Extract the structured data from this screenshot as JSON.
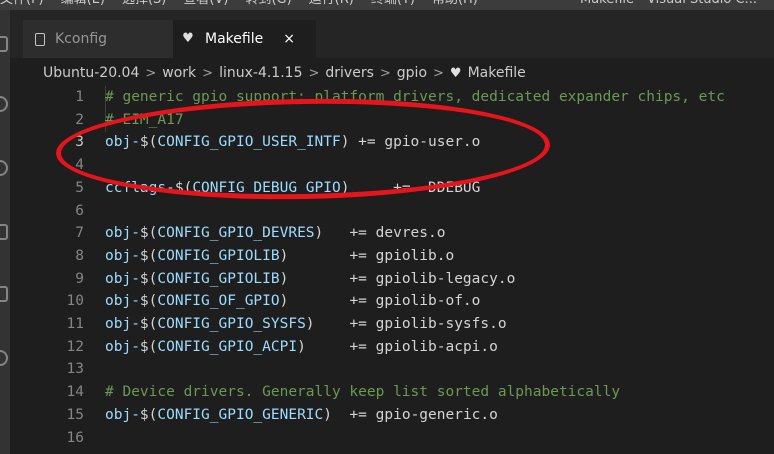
{
  "menu": {
    "items": [
      "文件(F)",
      "编辑(E)",
      "选择(S)",
      "查看(V)",
      "转到(G)",
      "运行(R)",
      "终端(T)",
      "帮助(H)"
    ],
    "window_title": "Makefile - Visual Studio C..."
  },
  "activity_icons": [
    "explorer-icon",
    "search-icon",
    "source-control-icon",
    "run-debug-icon",
    "extensions-icon",
    "remote-icon"
  ],
  "tabs": [
    {
      "label": "Kconfig",
      "icon": "file-icon",
      "active": false
    },
    {
      "label": "Makefile",
      "icon": "makefile-icon",
      "active": true,
      "close_glyph": "×"
    }
  ],
  "breadcrumb": [
    "Ubuntu-20.04",
    "work",
    "linux-4.1.15",
    "drivers",
    "gpio",
    "Makefile"
  ],
  "breadcrumb_sep": ">",
  "code_lines": [
    {
      "n": "1",
      "parts": [
        [
          "# generic gpio support: platform drivers, dedicated expander chips, etc",
          "c-comment"
        ]
      ]
    },
    {
      "n": "2",
      "parts": [
        [
          "# EIM_A17",
          "c-comment"
        ]
      ]
    },
    {
      "n": "3",
      "parts": [
        [
          "obj-",
          "c-var"
        ],
        [
          "$(",
          "c-op"
        ],
        [
          "CONFIG_GPIO_USER_INTF",
          "c-var"
        ],
        [
          ") += gpio-user.o",
          "c-text"
        ]
      ]
    },
    {
      "n": "4",
      "parts": []
    },
    {
      "n": "5",
      "parts": [
        [
          "ccflags-",
          "c-var"
        ],
        [
          "$(",
          "c-op"
        ],
        [
          "CONFIG_DEBUG_GPIO",
          "c-var"
        ],
        [
          ")     += -DDEBUG",
          "c-text"
        ]
      ]
    },
    {
      "n": "6",
      "parts": []
    },
    {
      "n": "7",
      "parts": [
        [
          "obj-",
          "c-var"
        ],
        [
          "$(",
          "c-op"
        ],
        [
          "CONFIG_GPIO_DEVRES",
          "c-var"
        ],
        [
          ")   += devres.o",
          "c-text"
        ]
      ]
    },
    {
      "n": "8",
      "parts": [
        [
          "obj-",
          "c-var"
        ],
        [
          "$(",
          "c-op"
        ],
        [
          "CONFIG_GPIOLIB",
          "c-var"
        ],
        [
          ")       += gpiolib.o",
          "c-text"
        ]
      ]
    },
    {
      "n": "9",
      "parts": [
        [
          "obj-",
          "c-var"
        ],
        [
          "$(",
          "c-op"
        ],
        [
          "CONFIG_GPIOLIB",
          "c-var"
        ],
        [
          ")       += gpiolib-legacy.o",
          "c-text"
        ]
      ]
    },
    {
      "n": "10",
      "parts": [
        [
          "obj-",
          "c-var"
        ],
        [
          "$(",
          "c-op"
        ],
        [
          "CONFIG_OF_GPIO",
          "c-var"
        ],
        [
          ")       += gpiolib-of.o",
          "c-text"
        ]
      ]
    },
    {
      "n": "11",
      "parts": [
        [
          "obj-",
          "c-var"
        ],
        [
          "$(",
          "c-op"
        ],
        [
          "CONFIG_GPIO_SYSFS",
          "c-var"
        ],
        [
          ")    += gpiolib-sysfs.o",
          "c-text"
        ]
      ]
    },
    {
      "n": "12",
      "parts": [
        [
          "obj-",
          "c-var"
        ],
        [
          "$(",
          "c-op"
        ],
        [
          "CONFIG_GPIO_ACPI",
          "c-var"
        ],
        [
          ")     += gpiolib-acpi.o",
          "c-text"
        ]
      ]
    },
    {
      "n": "13",
      "parts": []
    },
    {
      "n": "14",
      "parts": [
        [
          "# Device drivers. Generally keep list sorted alphabetically",
          "c-comment"
        ]
      ]
    },
    {
      "n": "15",
      "parts": [
        [
          "obj-",
          "c-var"
        ],
        [
          "$(",
          "c-op"
        ],
        [
          "CONFIG_GPIO_GENERIC",
          "c-var"
        ],
        [
          ")  += gpio-generic.o",
          "c-text"
        ]
      ]
    },
    {
      "n": "16",
      "parts": []
    }
  ],
  "colors": {
    "editor_bg": "#1e1e1e",
    "comment": "#6a9955",
    "variable": "#9cdcfe",
    "annotation_circle": "#e8141c"
  }
}
